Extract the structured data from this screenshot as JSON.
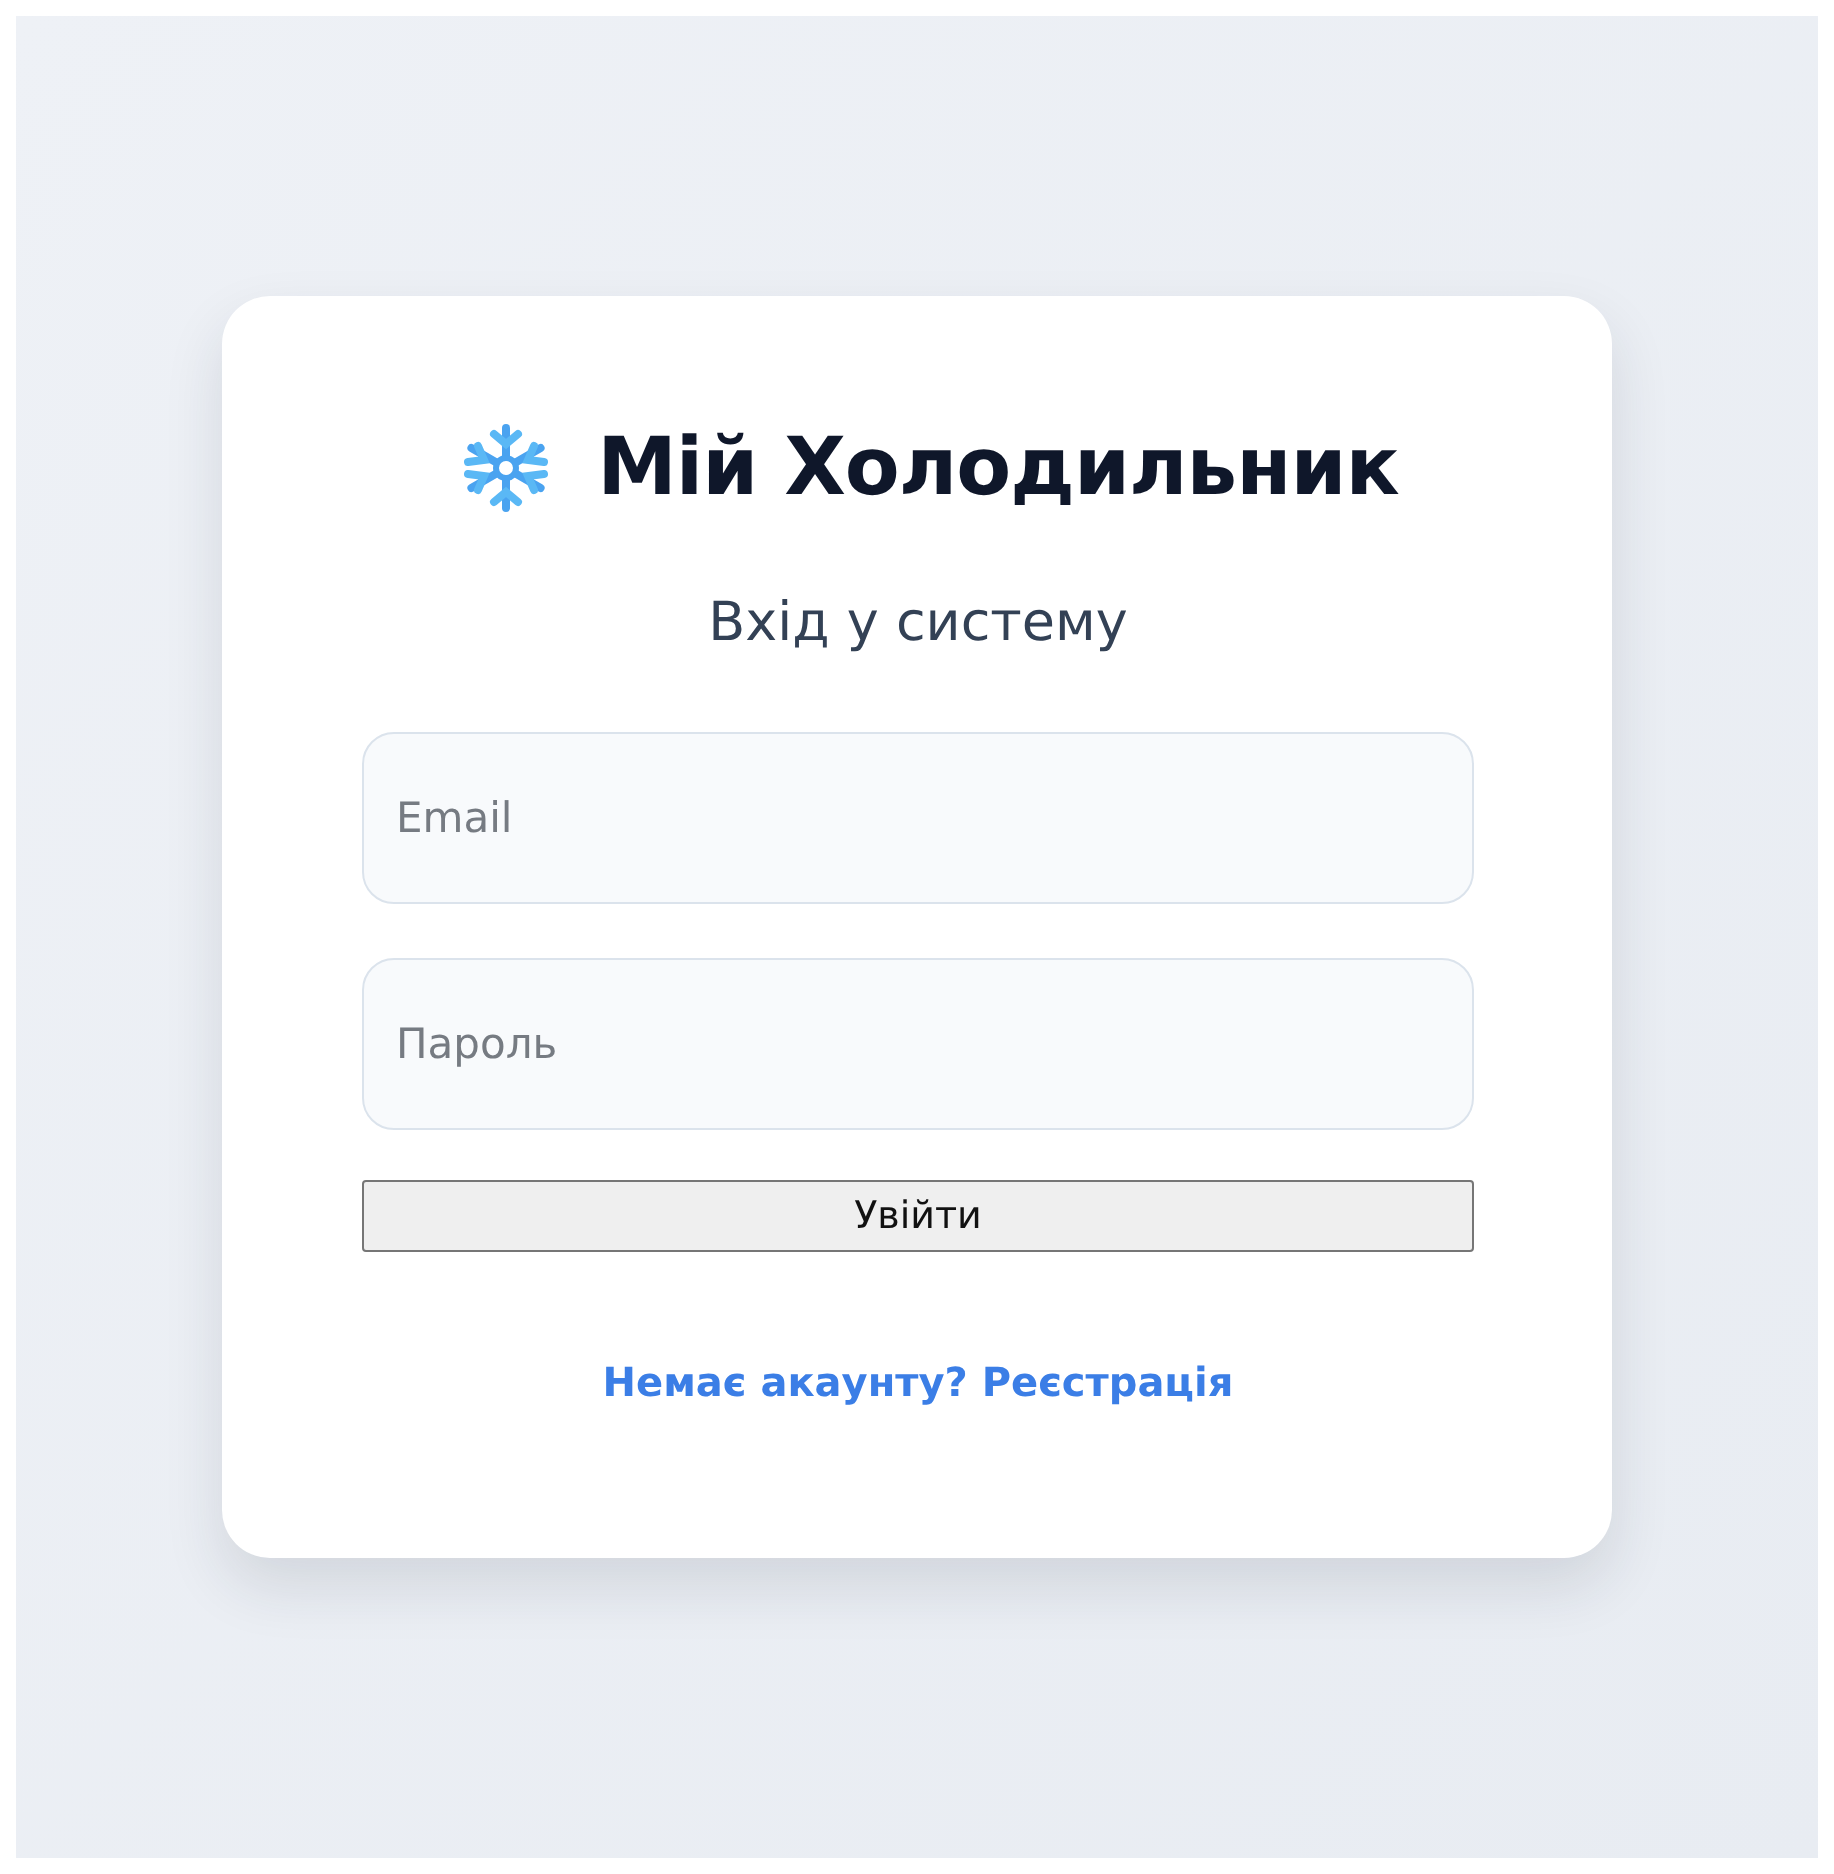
{
  "app": {
    "title": "Мій Холодильник"
  },
  "login": {
    "heading": "Вхід у систему",
    "fields": [
      {
        "placeholder": "Email"
      },
      {
        "placeholder": "Пароль"
      }
    ],
    "submit": "Увійти",
    "register_link": "Немає акаунту? Реєстрація"
  }
}
